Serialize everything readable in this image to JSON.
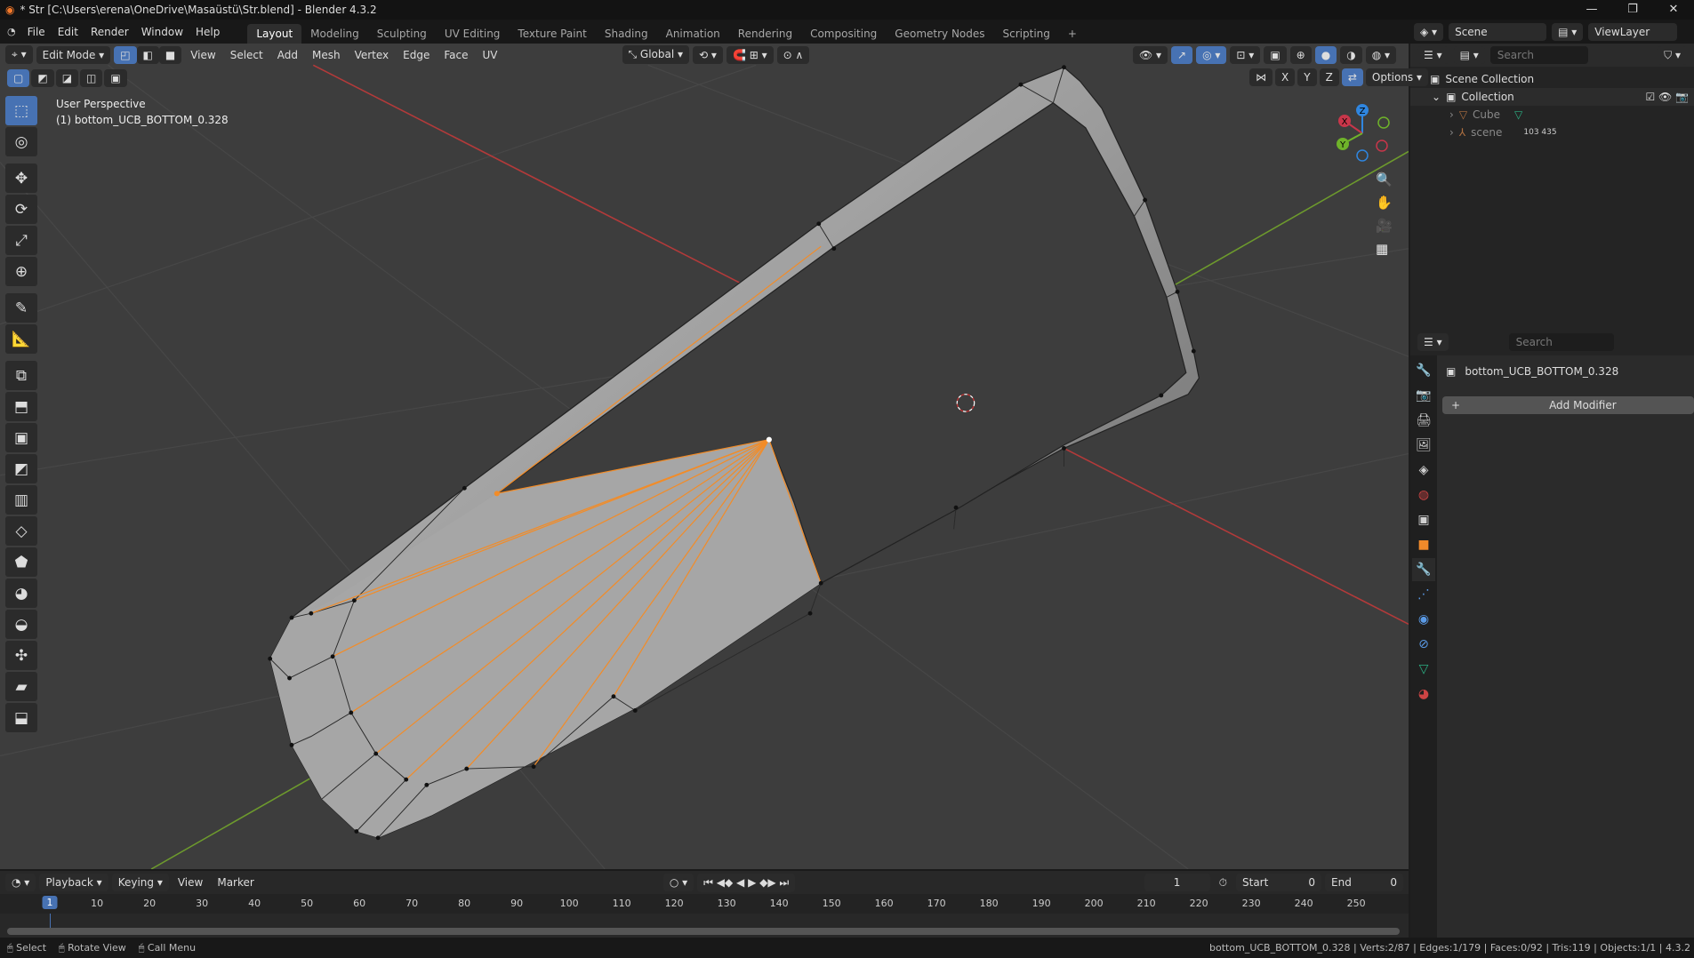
{
  "window": {
    "title": "* Str [C:\\Users\\erena\\OneDrive\\Masaüstü\\Str.blend] - Blender 4.3.2",
    "minimize": "—",
    "maximize": "❐",
    "close": "✕"
  },
  "menu": [
    "File",
    "Edit",
    "Render",
    "Window",
    "Help"
  ],
  "workspaces": [
    {
      "label": "Layout",
      "active": true
    },
    {
      "label": "Modeling"
    },
    {
      "label": "Sculpting"
    },
    {
      "label": "UV Editing"
    },
    {
      "label": "Texture Paint"
    },
    {
      "label": "Shading"
    },
    {
      "label": "Animation"
    },
    {
      "label": "Rendering"
    },
    {
      "label": "Compositing"
    },
    {
      "label": "Geometry Nodes"
    },
    {
      "label": "Scripting"
    }
  ],
  "add_workspace": "+",
  "viewport": {
    "mode": "Edit Mode",
    "menus": [
      "View",
      "Select",
      "Add",
      "Mesh",
      "Vertex",
      "Edge",
      "Face",
      "UV"
    ],
    "transform_orientation": "Global",
    "axes": [
      "X",
      "Y",
      "Z"
    ],
    "options": "Options",
    "overlay_line1": "User Perspective",
    "overlay_line2": "(1) bottom_UCB_BOTTOM_0.328",
    "gizmo": {
      "x": "X",
      "y": "Y",
      "z": "Z"
    },
    "colors": {
      "x_axis": "#b33a3a",
      "y_axis": "#6d9a2d",
      "selected": "#f28c28",
      "background": "#3d3d3d"
    }
  },
  "tools": [
    "select-box",
    "cursor",
    "move",
    "rotate",
    "scale",
    "transform",
    "annotate",
    "measure",
    "add-cube",
    "extrude",
    "inset",
    "bevel",
    "loop-cut",
    "knife",
    "poly-build",
    "spin",
    "smooth",
    "shrink",
    "shear",
    "rip"
  ],
  "scene": {
    "label": "Scene",
    "view_layer": "ViewLayer"
  },
  "outliner": {
    "search_placeholder": "Search",
    "scene_collection": "Scene Collection",
    "collection": "Collection",
    "items": [
      {
        "name": "Cube"
      },
      {
        "name": "scene",
        "badge": "103 435"
      }
    ]
  },
  "properties": {
    "search_placeholder": "Search",
    "object_name": "bottom_UCB_BOTTOM_0.328",
    "add_modifier": "Add Modifier"
  },
  "timeline": {
    "menus": [
      "Playback",
      "Keying",
      "View",
      "Marker"
    ],
    "current_frame": "1",
    "start_label": "Start",
    "start": "0",
    "end_label": "End",
    "end": "0",
    "ticks": [
      "1",
      "10",
      "20",
      "30",
      "40",
      "50",
      "60",
      "70",
      "80",
      "90",
      "100",
      "110",
      "120",
      "130",
      "140",
      "150",
      "160",
      "170",
      "180",
      "190",
      "200",
      "210",
      "220",
      "230",
      "240",
      "250"
    ]
  },
  "status": {
    "hints": [
      "Select",
      "Rotate View",
      "Call Menu"
    ],
    "stats": "bottom_UCB_BOTTOM_0.328 | Verts:2/87 | Edges:1/179 | Faces:0/92 | Tris:119 | Objects:1/1 | 4.3.2"
  }
}
